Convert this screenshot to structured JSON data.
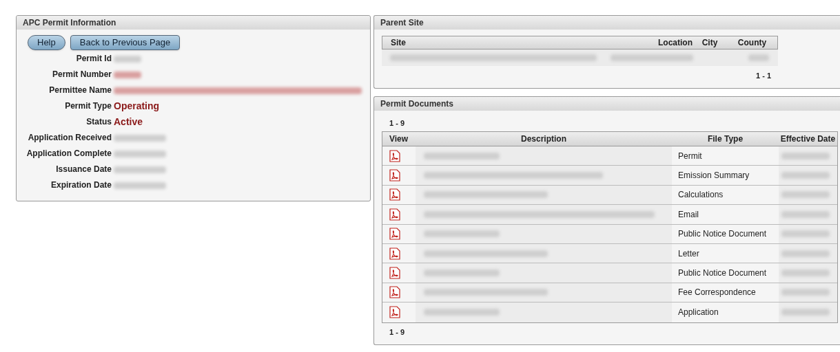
{
  "permit_info": {
    "title": "APC Permit Information",
    "buttons": [
      {
        "label": "Help",
        "kind": "round"
      },
      {
        "label": "Back to Previous Page",
        "kind": "square"
      }
    ],
    "fields": [
      {
        "label": "Permit Id",
        "redacted": true,
        "emphasis": false
      },
      {
        "label": "Permit Number",
        "redacted": true,
        "emphasis": true
      },
      {
        "label": "Permittee Name",
        "redacted": true,
        "emphasis": true
      },
      {
        "label": "Permit Type",
        "value": "Operating",
        "emphasis": true
      },
      {
        "label": "Status",
        "value": "Active",
        "emphasis": true
      },
      {
        "label": "Application Received",
        "redacted": true,
        "emphasis": false
      },
      {
        "label": "Application Complete",
        "redacted": true,
        "emphasis": false
      },
      {
        "label": "Issuance Date",
        "redacted": true,
        "emphasis": false
      },
      {
        "label": "Expiration Date",
        "redacted": true,
        "emphasis": false
      }
    ]
  },
  "parent_site": {
    "title": "Parent Site",
    "columns": [
      "Site",
      "Location",
      "City",
      "County"
    ],
    "rows": [
      {
        "redacted": true
      }
    ],
    "pager": "1 - 1"
  },
  "permit_documents": {
    "title": "Permit Documents",
    "pager_top": "1 - 9",
    "columns": [
      "View",
      "Description",
      "File Type",
      "Effective Date"
    ],
    "rows": [
      {
        "file_type": "Permit"
      },
      {
        "file_type": "Emission Summary"
      },
      {
        "file_type": "Calculations"
      },
      {
        "file_type": "Email"
      },
      {
        "file_type": "Public Notice Document"
      },
      {
        "file_type": "Letter"
      },
      {
        "file_type": "Public Notice Document"
      },
      {
        "file_type": "Fee Correspondence"
      },
      {
        "file_type": "Application"
      }
    ],
    "pager_bottom": "1 - 9"
  }
}
